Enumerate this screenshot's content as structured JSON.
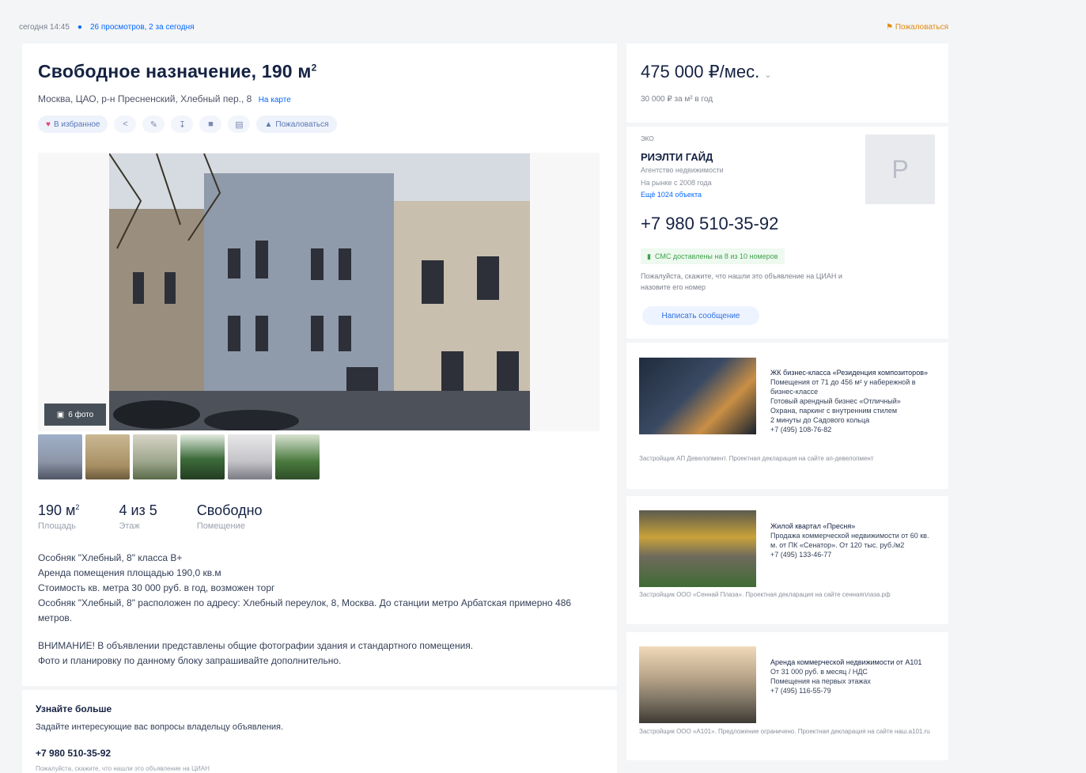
{
  "topbar": {
    "updated": "сегодня 14:45",
    "views_link": "26 просмотров, 2 за сегодня",
    "complain": "Пожаловаться"
  },
  "listing": {
    "title": "Свободное назначение, 190 м",
    "title_sup": "2",
    "address": "Москва, ЦАО, р-н Пресненский, Хлебный пер., 8",
    "on_map": "На карте",
    "favorite": "В избранное",
    "report": "Пожаловаться",
    "photo_count": "6 фото",
    "thumbnails": [
      "thumb-1",
      "thumb-2",
      "thumb-3",
      "thumb-4",
      "thumb-5",
      "thumb-6"
    ],
    "stats": [
      {
        "value": "190 м",
        "sup": "2",
        "label": "Площадь"
      },
      {
        "value": "4 из 5",
        "sup": "",
        "label": "Этаж"
      },
      {
        "value": "Свободно",
        "sup": "",
        "label": "Помещение"
      }
    ],
    "description": [
      "Особняк \"Хлебный, 8\" класса B+",
      "Аренда помещения площадью 190,0 кв.м",
      "Стоимость кв. метра 30 000 руб. в год, возможен торг",
      "Особняк \"Хлебный, 8\" расположен по адресу: Хлебный переулок, 8, Москва. До станции метро Арбатская примерно 486 метров.",
      "ВНИМАНИЕ! В объявлении представлены общие фотографии здания и стандартного помещения.",
      "Фото и планировку по данному блоку запрашивайте дополнительно."
    ]
  },
  "more": {
    "heading": "Узнайте больше",
    "subtitle": "Задайте интересующие вас вопросы владельцу объявления.",
    "phone": "+7 980 510-35-92",
    "note": "Пожалуйста, скажите, что нашли это объявление на ЦИАН"
  },
  "price": {
    "value": "475 000 ₽/мес.",
    "sub": "30 000 ₽ за м² в год"
  },
  "agent": {
    "type": "ЭКО",
    "name": "РИЭЛТИ ГАЙД",
    "role": "Агентство недвижимости",
    "since": "На рынке с 2008 года",
    "objects": "Ещё 1024 объекта",
    "avatar_letter": "P",
    "phone": "+7 980 510-35-92",
    "sms": "СМС доставлены на 8 из 10 номеров",
    "note": "Пожалуйста, скажите, что нашли это объявление на ЦИАН и назовите его номер",
    "write_button": "Написать сообщение"
  },
  "ads": [
    {
      "text": [
        "ЖК бизнес-класса «Резиденция композиторов»",
        "Помещения от 71 до 456 м² у набережной в бизнес-классе",
        "Готовый арендный бизнес «Отличный»",
        "Охрана, паркинг с внутренним стилем",
        "2 минуты до Садового кольца",
        "+7 (495) 108-76-82"
      ],
      "dev": "Застройщик АП Девелопмент. Проектная декларация на сайте ап-девелопмент"
    },
    {
      "text": [
        "Жилой квартал «Пресня»",
        "Продажа коммерческой недвижимости от 60 кв. м. от ПК «Сенатор». От 120 тыс. руб./м2",
        "+7 (495) 133-46-77"
      ],
      "dev": "Застройщик ООО «Сеннай Плаза». Проектная декларация на сайте сеннаяплаза.рф"
    },
    {
      "text": [
        "Аренда коммерческой недвижимости от А101",
        "От 31 000 руб. в месяц / НДС",
        "Помещения на первых этажах",
        "+7 (495) 116-55-79"
      ],
      "dev": "Застройщик ООО «А101». Предложение ограничено. Проектная декларация на сайте наш.а101.ru"
    }
  ],
  "colors": {
    "accent": "#0468ff",
    "title": "#152242",
    "complain": "#e48a12",
    "sms_green": "#3fa34d"
  }
}
